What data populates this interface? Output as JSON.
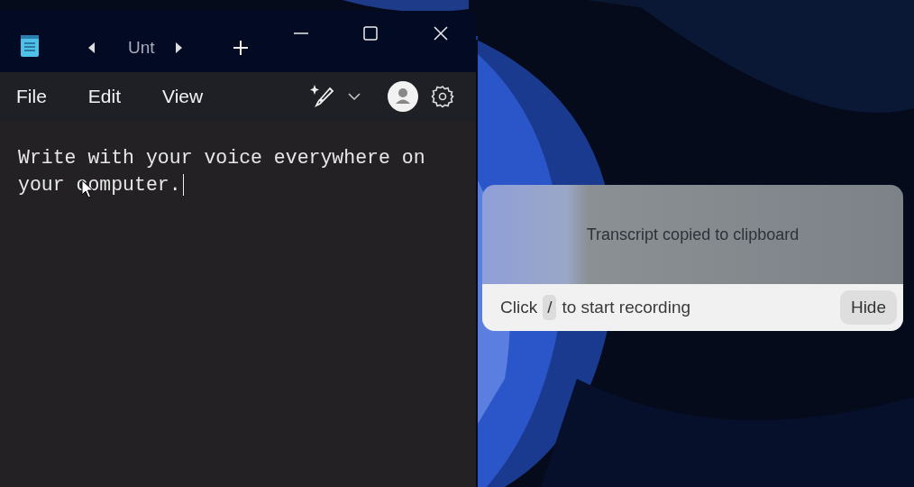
{
  "notepad": {
    "tab_title": "Unt",
    "menu": [
      "File",
      "Edit",
      "View"
    ],
    "text": "Write with your voice everywhere on your computer."
  },
  "popup": {
    "message": "Transcript copied to clipboard",
    "hint_before": "Click",
    "hint_key": "/",
    "hint_after": "to start recording",
    "button": "Hide"
  }
}
